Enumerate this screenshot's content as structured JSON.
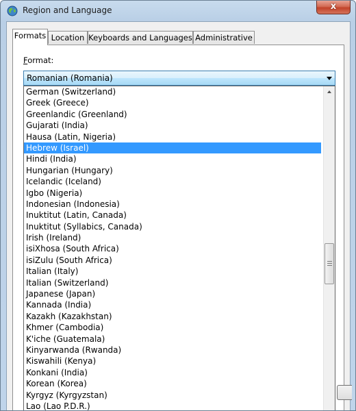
{
  "window": {
    "title": "Region and Language",
    "close_label": "x"
  },
  "tabs": [
    {
      "label": "Formats",
      "active": true
    },
    {
      "label": "Location",
      "active": false
    },
    {
      "label": "Keyboards and Languages",
      "active": false
    },
    {
      "label": "Administrative",
      "active": false
    }
  ],
  "format": {
    "label_mnemonic": "F",
    "label_rest": "ormat:",
    "selected_value": "Romanian (Romania)"
  },
  "dropdown": {
    "selected_item": "Hebrew (Israel)",
    "items": [
      "German (Switzerland)",
      "Greek (Greece)",
      "Greenlandic (Greenland)",
      "Gujarati (India)",
      "Hausa (Latin, Nigeria)",
      "Hebrew (Israel)",
      "Hindi (India)",
      "Hungarian (Hungary)",
      "Icelandic (Iceland)",
      "Igbo (Nigeria)",
      "Indonesian (Indonesia)",
      "Inuktitut (Latin, Canada)",
      "Inuktitut (Syllabics, Canada)",
      "Irish (Ireland)",
      "isiXhosa (South Africa)",
      "isiZulu (South Africa)",
      "Italian (Italy)",
      "Italian (Switzerland)",
      "Japanese (Japan)",
      "Kannada (India)",
      "Kazakh (Kazakhstan)",
      "Khmer (Cambodia)",
      "K'iche (Guatemala)",
      "Kinyarwanda (Rwanda)",
      "Kiswahili (Kenya)",
      "Konkani (India)",
      "Korean (Korea)",
      "Kyrgyz (Kyrgyzstan)",
      "Lao (Lao P.D.R.)"
    ]
  },
  "colors": {
    "selection": "#3399ff",
    "combo_border": "#3c7fb1",
    "close_button": "#c2432a"
  }
}
